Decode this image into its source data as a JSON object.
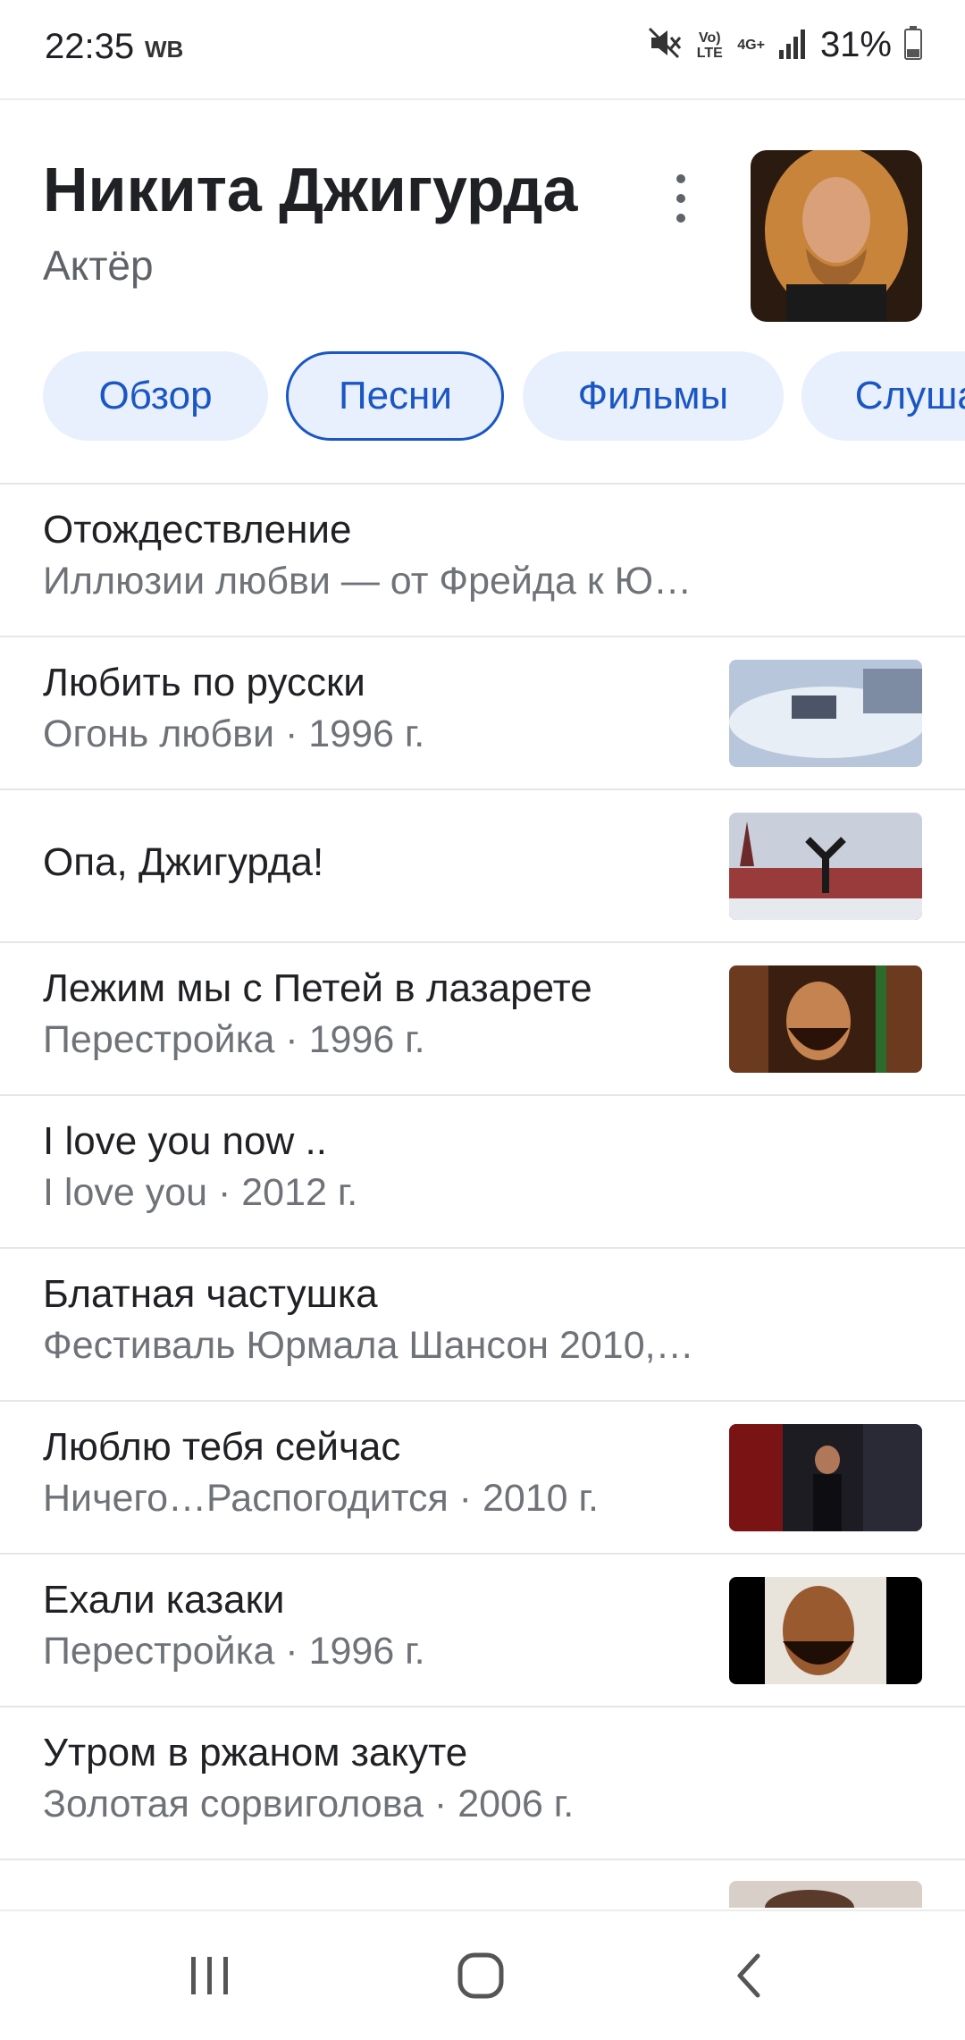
{
  "status_bar": {
    "time": "22:35",
    "carrier": "WB",
    "volte_label": "Vo) LTE",
    "network_label": "4G+",
    "battery_percent": "31%",
    "icons": [
      "mute-icon",
      "volte-icon",
      "4g-icon",
      "signal-icon",
      "battery-icon"
    ]
  },
  "header": {
    "name": "Никита Джигурда",
    "description": "Актёр",
    "more_icon": "more-vert-icon"
  },
  "tabs": [
    {
      "label": "Обзор",
      "active": false
    },
    {
      "label": "Песни",
      "active": true
    },
    {
      "label": "Фильмы",
      "active": false
    },
    {
      "label": "Слушать",
      "active": false
    }
  ],
  "songs": [
    {
      "title": "Отождествление",
      "subtitle": "Иллюзии любви — от Фрейда к Ю…",
      "has_thumb": false
    },
    {
      "title": "Любить по русски",
      "subtitle": "Огонь любви · 1996 г.",
      "has_thumb": true
    },
    {
      "title": "Опа, Джигурда!",
      "subtitle": "",
      "has_thumb": true
    },
    {
      "title": "Лежим мы с Петей в лазарете",
      "subtitle": "Перестройка · 1996 г.",
      "has_thumb": true
    },
    {
      "title": "I love you now ..",
      "subtitle": "I love you · 2012 г.",
      "has_thumb": false
    },
    {
      "title": "Блатная частушка",
      "subtitle": "Фестиваль Юрмала Шансон 2010,…",
      "has_thumb": false
    },
    {
      "title": "Люблю тебя сейчас",
      "subtitle": "Ничего…Распогодится · 2010 г.",
      "has_thumb": true
    },
    {
      "title": "Ехали казаки",
      "subtitle": "Перестройка · 1996 г.",
      "has_thumb": true
    },
    {
      "title": "Утром в ржаном закуте",
      "subtitle": "Золотая сорвиголова · 2006 г.",
      "has_thumb": false
    }
  ],
  "colors": {
    "accent": "#1a56c4",
    "chip_bg": "#e8f0fe",
    "text_primary": "#202124",
    "text_secondary": "#6f7378",
    "divider": "#e6e6e6"
  },
  "nav_bar": {
    "icons": [
      "recent-apps-icon",
      "home-icon",
      "back-icon"
    ]
  }
}
